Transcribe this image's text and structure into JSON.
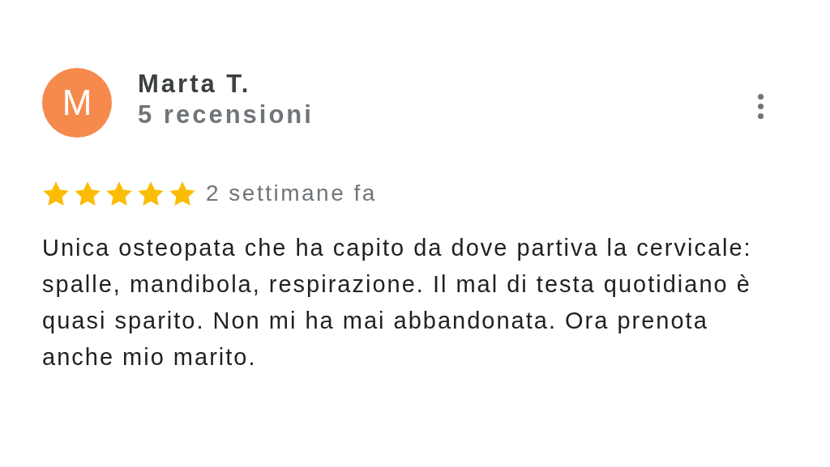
{
  "review": {
    "avatar_letter": "M",
    "author": "Marta T.",
    "review_count": "5 recensioni",
    "stars": 5,
    "time": "2 settimane fa",
    "text": "Unica osteopata che ha capito da dove partiva la cervicale: spalle, mandibola, respirazione. Il mal di testa quotidiano è quasi sparito. Non mi ha mai abbandonata. Ora prenota anche mio marito."
  }
}
